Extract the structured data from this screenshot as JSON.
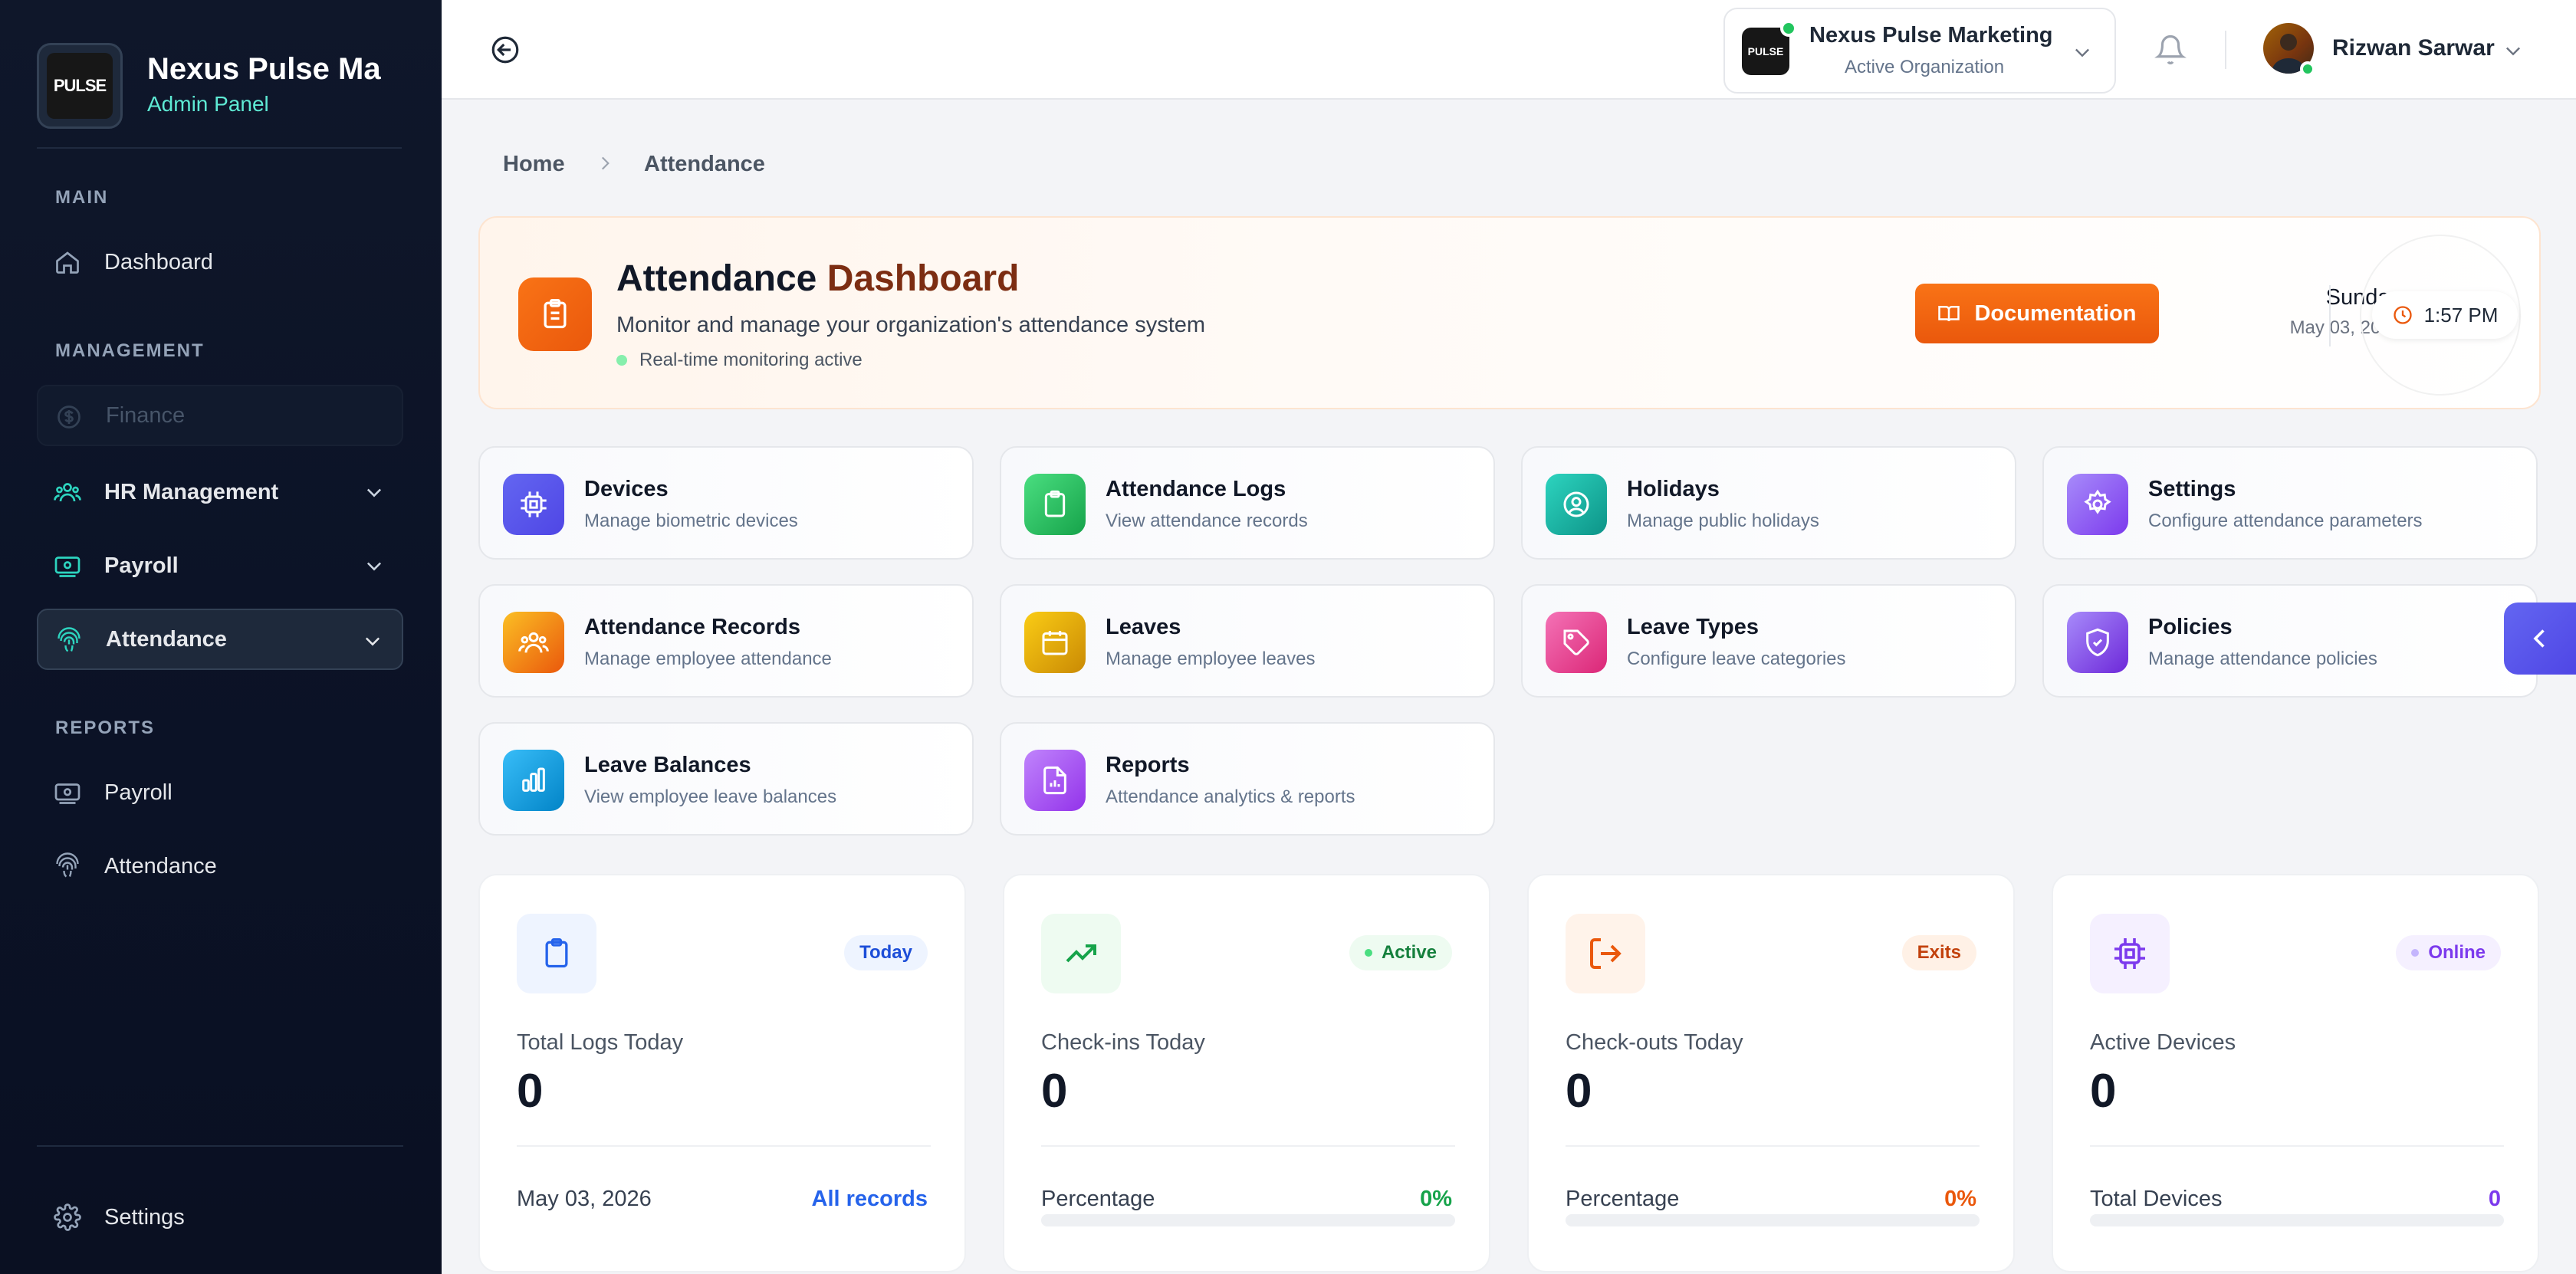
{
  "sidebar": {
    "brand_name": "Nexus Pulse Ma",
    "brand_sub": "Admin Panel",
    "logo_text": "PULSE",
    "sections": {
      "main": "MAIN",
      "management": "MANAGEMENT",
      "reports": "REPORTS"
    },
    "items": {
      "dashboard": "Dashboard",
      "finance": "Finance",
      "hr_management": "HR Management",
      "payroll": "Payroll",
      "attendance": "Attendance",
      "report_payroll": "Payroll",
      "report_attendance": "Attendance",
      "settings": "Settings"
    }
  },
  "topbar": {
    "org_name": "Nexus Pulse Marketing",
    "org_status": "Active Organization",
    "org_logo_text": "PULSE",
    "user_name": "Rizwan Sarwar"
  },
  "breadcrumb": {
    "home": "Home",
    "current": "Attendance"
  },
  "hero": {
    "title_part1": "Attendance",
    "title_part2": "Dashboard",
    "subtitle": "Monitor and manage your organization's attendance system",
    "live_status": "Real-time monitoring active",
    "doc_button": "Documentation",
    "day": "Sunday",
    "date": "May 03, 2026",
    "time": "1:57 PM"
  },
  "modules": [
    {
      "title": "Devices",
      "desc": "Manage biometric devices",
      "icon": "chip-icon",
      "color": "#6366f1"
    },
    {
      "title": "Attendance Logs",
      "desc": "View attendance records",
      "icon": "clipboard-icon",
      "color": "#22c55e"
    },
    {
      "title": "Holidays",
      "desc": "Manage public holidays",
      "icon": "user-circle-icon",
      "color": "#14b8a6"
    },
    {
      "title": "Settings",
      "desc": "Configure attendance parameters",
      "icon": "gear-icon",
      "color": "#8b5cf6"
    },
    {
      "title": "Attendance Records",
      "desc": "Manage employee attendance",
      "icon": "users-icon",
      "color": "#f59e0b"
    },
    {
      "title": "Leaves",
      "desc": "Manage employee leaves",
      "icon": "calendar-icon",
      "color": "#eab308"
    },
    {
      "title": "Leave Types",
      "desc": "Configure leave categories",
      "icon": "tag-icon",
      "color": "#ec4899"
    },
    {
      "title": "Policies",
      "desc": "Manage attendance policies",
      "icon": "shield-icon",
      "color": "#8b5cf6"
    },
    {
      "title": "Leave Balances",
      "desc": "View employee leave balances",
      "icon": "bar-chart-icon",
      "color": "#0ea5e9"
    },
    {
      "title": "Reports",
      "desc": "Attendance analytics & reports",
      "icon": "report-icon",
      "color": "#a855f7"
    }
  ],
  "stats": [
    {
      "label": "Total Logs Today",
      "value": "0",
      "badge": "Today",
      "footer_left": "May 03, 2026",
      "footer_right": "All records",
      "accent": "#2563eb"
    },
    {
      "label": "Check-ins Today",
      "value": "0",
      "badge": "Active",
      "footer_left": "Percentage",
      "footer_right": "0%",
      "progress": 0,
      "accent": "#16a34a"
    },
    {
      "label": "Check-outs Today",
      "value": "0",
      "badge": "Exits",
      "footer_left": "Percentage",
      "footer_right": "0%",
      "progress": 0,
      "accent": "#ea580c"
    },
    {
      "label": "Active Devices",
      "value": "0",
      "badge": "Online",
      "footer_left": "Total Devices",
      "footer_right": "0",
      "progress": 0,
      "accent": "#7c3aed"
    }
  ]
}
